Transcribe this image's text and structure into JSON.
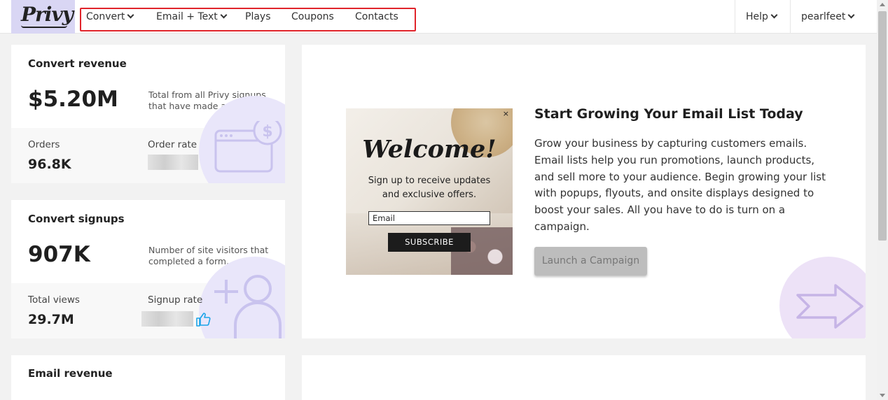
{
  "brand": {
    "logo_text": "Privy"
  },
  "nav": {
    "items": [
      {
        "label": "Convert",
        "dropdown": true
      },
      {
        "label": "Email + Text",
        "dropdown": true
      },
      {
        "label": "Plays",
        "dropdown": false
      },
      {
        "label": "Coupons",
        "dropdown": false
      },
      {
        "label": "Contacts",
        "dropdown": false
      }
    ],
    "help_label": "Help",
    "account_label": "pearlfeet"
  },
  "cards": {
    "convert_revenue": {
      "title": "Convert revenue",
      "value": "$5.20M",
      "description": "Total from all Privy signups that have made a purchase",
      "left_label": "Orders",
      "left_value": "96.8K",
      "right_label": "Order rate"
    },
    "convert_signups": {
      "title": "Convert signups",
      "value": "907K",
      "description": "Number of site visitors that completed a form.",
      "left_label": "Total views",
      "left_value": "29.7M",
      "right_label": "Signup rate"
    },
    "email_revenue": {
      "title": "Email revenue"
    }
  },
  "promo": {
    "title": "Start Growing Your Email List Today",
    "body": "Grow your business by capturing customers emails. Email lists help you run promotions, launch products, and sell more to your audience. Begin growing your list with popups, flyouts, and onsite displays designed to boost your sales. All you have to do is turn on a campaign.",
    "button_label": "Launch a Campaign",
    "mockup": {
      "close": "×",
      "heading": "Welcome!",
      "subtext": "Sign up to receive updates and exclusive offers.",
      "email_placeholder": "Email",
      "button_label": "SUBSCRIBE"
    }
  },
  "colors": {
    "nav_highlight": "#e0242b",
    "logo_bg": "#d9d6f4",
    "deco_lavender": "#e9e6fa",
    "icon_stroke": "#c9c3ee",
    "thumb_blue": "#1aa3e8"
  },
  "icons": [
    "chevron-down-icon",
    "browser-dollar-icon",
    "add-user-icon",
    "arrow-right-icon",
    "thumbs-up-icon"
  ]
}
